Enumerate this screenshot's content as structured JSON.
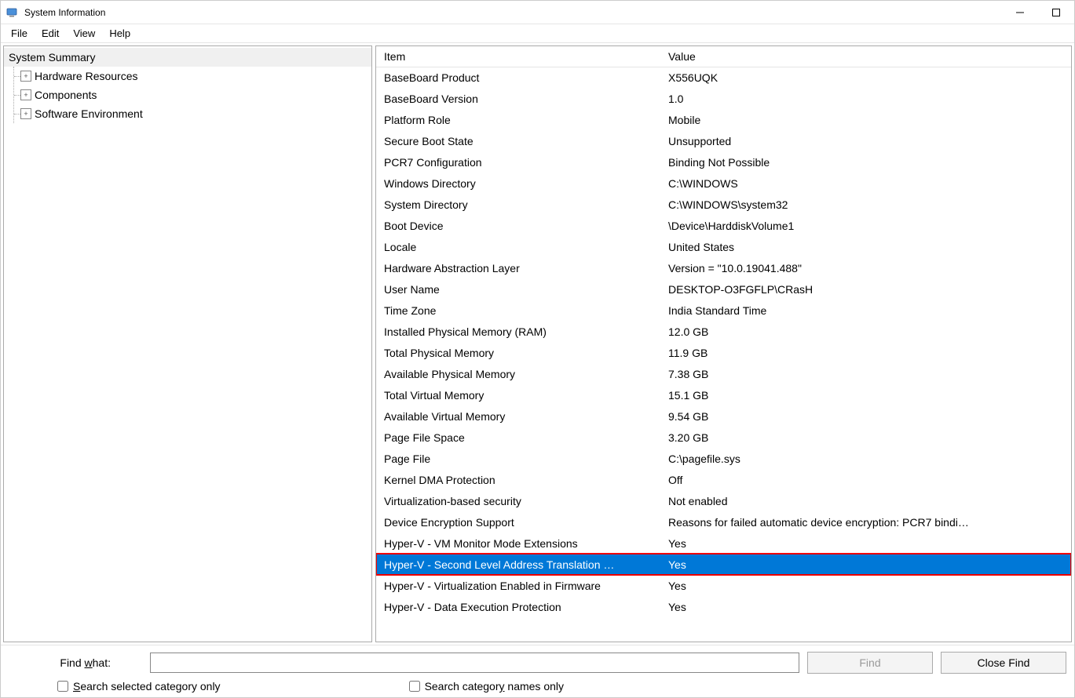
{
  "window": {
    "title": "System Information"
  },
  "menu": {
    "file": "File",
    "edit": "Edit",
    "view": "View",
    "help": "Help"
  },
  "tree": {
    "root": "System Summary",
    "children": [
      "Hardware Resources",
      "Components",
      "Software Environment"
    ]
  },
  "columns": {
    "item": "Item",
    "value": "Value"
  },
  "rows": [
    {
      "item": "BaseBoard Product",
      "value": "X556UQK"
    },
    {
      "item": "BaseBoard Version",
      "value": "1.0"
    },
    {
      "item": "Platform Role",
      "value": "Mobile"
    },
    {
      "item": "Secure Boot State",
      "value": "Unsupported"
    },
    {
      "item": "PCR7 Configuration",
      "value": "Binding Not Possible"
    },
    {
      "item": "Windows Directory",
      "value": "C:\\WINDOWS"
    },
    {
      "item": "System Directory",
      "value": "C:\\WINDOWS\\system32"
    },
    {
      "item": "Boot Device",
      "value": "\\Device\\HarddiskVolume1"
    },
    {
      "item": "Locale",
      "value": "United States"
    },
    {
      "item": "Hardware Abstraction Layer",
      "value": "Version = \"10.0.19041.488\""
    },
    {
      "item": "User Name",
      "value": "DESKTOP-O3FGFLP\\CRasH"
    },
    {
      "item": "Time Zone",
      "value": "India Standard Time"
    },
    {
      "item": "Installed Physical Memory (RAM)",
      "value": "12.0 GB"
    },
    {
      "item": "Total Physical Memory",
      "value": "11.9 GB"
    },
    {
      "item": "Available Physical Memory",
      "value": "7.38 GB"
    },
    {
      "item": "Total Virtual Memory",
      "value": "15.1 GB"
    },
    {
      "item": "Available Virtual Memory",
      "value": "9.54 GB"
    },
    {
      "item": "Page File Space",
      "value": "3.20 GB"
    },
    {
      "item": "Page File",
      "value": "C:\\pagefile.sys"
    },
    {
      "item": "Kernel DMA Protection",
      "value": "Off"
    },
    {
      "item": "Virtualization-based security",
      "value": "Not enabled"
    },
    {
      "item": "Device Encryption Support",
      "value": "Reasons for failed automatic device encryption: PCR7 bindi…"
    },
    {
      "item": "Hyper-V - VM Monitor Mode Extensions",
      "value": "Yes"
    },
    {
      "item": "Hyper-V - Second Level Address Translation …",
      "value": "Yes",
      "selected": true,
      "highlighted": true
    },
    {
      "item": "Hyper-V - Virtualization Enabled in Firmware",
      "value": "Yes"
    },
    {
      "item": "Hyper-V - Data Execution Protection",
      "value": "Yes"
    }
  ],
  "find": {
    "label_prefix": "Find ",
    "label_ul": "w",
    "label_suffix": "hat:",
    "value": "",
    "find_btn_prefix": "Fi",
    "find_btn_ul": "n",
    "find_btn_suffix": "d",
    "close_btn_prefix": "",
    "close_btn_ul": "C",
    "close_btn_suffix": "lose Find",
    "chk1_ul": "S",
    "chk1_rest": "earch selected category only",
    "chk2_prefix": "Search categor",
    "chk2_ul": "y",
    "chk2_suffix": " names only"
  }
}
